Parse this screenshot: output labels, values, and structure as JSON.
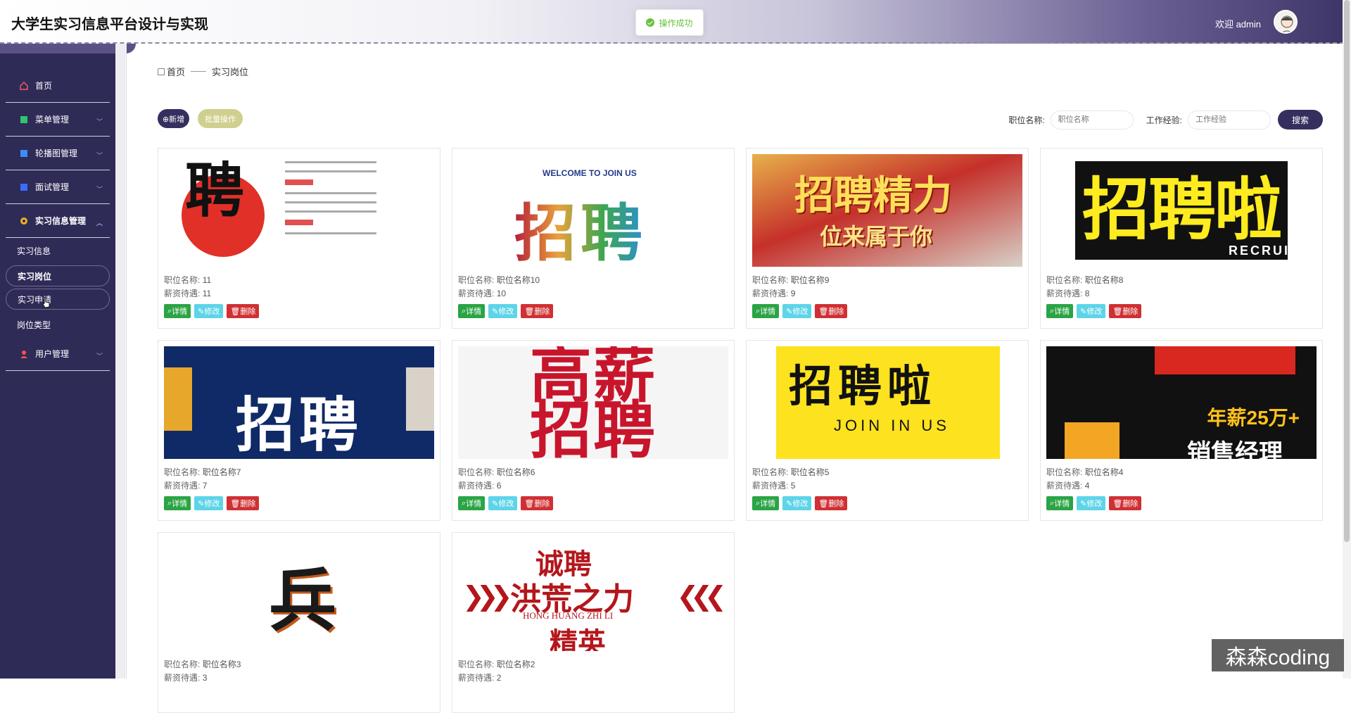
{
  "header": {
    "title": "大学生实习信息平台设计与实现",
    "welcome": "欢迎 admin",
    "toast": "操作成功"
  },
  "sidebar": {
    "items": [
      {
        "label": "首页",
        "icon": "home-icon"
      },
      {
        "label": "菜单管理",
        "icon": "menu-icon"
      },
      {
        "label": "轮播图管理",
        "icon": "carousel-icon"
      },
      {
        "label": "面试管理",
        "icon": "interview-icon"
      },
      {
        "label": "实习信息管理",
        "icon": "info-icon"
      },
      {
        "label": "用户管理",
        "icon": "user-icon"
      }
    ],
    "sub_items": [
      "实习信息",
      "实习岗位",
      "实习申请",
      "岗位类型"
    ],
    "active": "实习岗位"
  },
  "breadcrumb": {
    "home": "首页",
    "current": "实习岗位"
  },
  "toolbar": {
    "add_label": "⊕新增",
    "batch_label": "批量操作",
    "position_label": "职位名称:",
    "position_placeholder": "职位名称",
    "experience_label": "工作经验:",
    "experience_placeholder": "工作经验",
    "search_label": "搜索"
  },
  "card_labels": {
    "name_key": "职位名称:",
    "salary_key": "薪资待遇:",
    "view": "详情",
    "edit": "修改",
    "delete": "删除"
  },
  "cards": [
    {
      "name": "11",
      "salary": "11",
      "banner": "招聘"
    },
    {
      "name": "职位名称10",
      "salary": "10",
      "banner": "招聘"
    },
    {
      "name": "职位名称9",
      "salary": "9",
      "banner": "招聘精力"
    },
    {
      "name": "职位名称8",
      "salary": "8",
      "banner": "招聘啦"
    },
    {
      "name": "职位名称7",
      "salary": "7",
      "banner": "招聘"
    },
    {
      "name": "职位名称6",
      "salary": "6",
      "banner": "高薪招聘"
    },
    {
      "name": "职位名称5",
      "salary": "5",
      "banner": "招聘啦"
    },
    {
      "name": "职位名称4",
      "salary": "4",
      "banner": "年薪25万+"
    },
    {
      "name": "职位名称3",
      "salary": "3",
      "banner": "兵"
    },
    {
      "name": "职位名称2",
      "salary": "2",
      "banner": "洪荒之力"
    }
  ],
  "banners": {
    "b1": "聘",
    "b2_en": "WELCOME TO JOIN US",
    "b2_zh": "招聘",
    "b3_a": "招聘精力",
    "b3_b": "位来属于你",
    "b4": "招聘啦",
    "b4_en": "RECRUIT",
    "b5": "招聘",
    "b6": "高薪招聘",
    "b7": "招聘啦",
    "b7_en": "JOIN IN US",
    "b8_a": "年薪25万+",
    "b8_b": "销售经理",
    "b9": "兵",
    "b10_a": "诚聘",
    "b10_b": "洪荒之力",
    "b10_en": "HONG HUANG ZHI LI",
    "b10_c": "精英"
  },
  "watermark": "森森coding",
  "colors": {
    "sidebar_bg": "#2f2b57",
    "primary": "#342f5f",
    "view": "#2aa445",
    "edit": "#5dd4e8",
    "delete": "#d03033",
    "success": "#67c23a"
  }
}
